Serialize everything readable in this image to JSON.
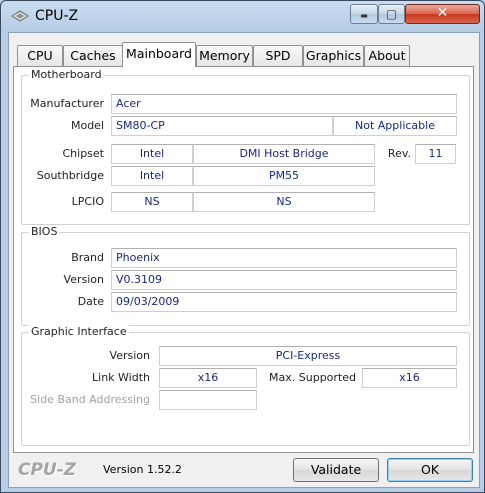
{
  "window": {
    "title": "CPU-Z",
    "close_glyph": "✕",
    "min_glyph": "▬",
    "max_glyph": "▢"
  },
  "tabs": [
    {
      "label": "CPU"
    },
    {
      "label": "Caches"
    },
    {
      "label": "Mainboard"
    },
    {
      "label": "Memory"
    },
    {
      "label": "SPD"
    },
    {
      "label": "Graphics"
    },
    {
      "label": "About"
    }
  ],
  "active_tab": "Mainboard",
  "motherboard": {
    "title": "Motherboard",
    "manufacturer_label": "Manufacturer",
    "manufacturer": "Acer",
    "model_label": "Model",
    "model": "SM80-CP",
    "model_rev": "Not Applicable",
    "chipset_label": "Chipset",
    "chipset_vendor": "Intel",
    "chipset_name": "DMI Host Bridge",
    "rev_label": "Rev.",
    "rev": "11",
    "southbridge_label": "Southbridge",
    "southbridge_vendor": "Intel",
    "southbridge_name": "PM55",
    "lpcio_label": "LPCIO",
    "lpcio_vendor": "NS",
    "lpcio_name": "NS"
  },
  "bios": {
    "title": "BIOS",
    "brand_label": "Brand",
    "brand": "Phoenix",
    "version_label": "Version",
    "version": "V0.3109",
    "date_label": "Date",
    "date": "09/03/2009"
  },
  "graphic_interface": {
    "title": "Graphic Interface",
    "version_label": "Version",
    "version": "PCI-Express",
    "link_width_label": "Link Width",
    "link_width": "x16",
    "max_supported_label": "Max. Supported",
    "max_supported": "x16",
    "side_band_label": "Side Band Addressing",
    "side_band": ""
  },
  "footer": {
    "brand": "CPU-Z",
    "version": "Version 1.52.2",
    "validate_label": "Validate",
    "ok_label": "OK"
  },
  "colors": {
    "value_text": "#1a2780",
    "close_button": "#c8371e"
  }
}
